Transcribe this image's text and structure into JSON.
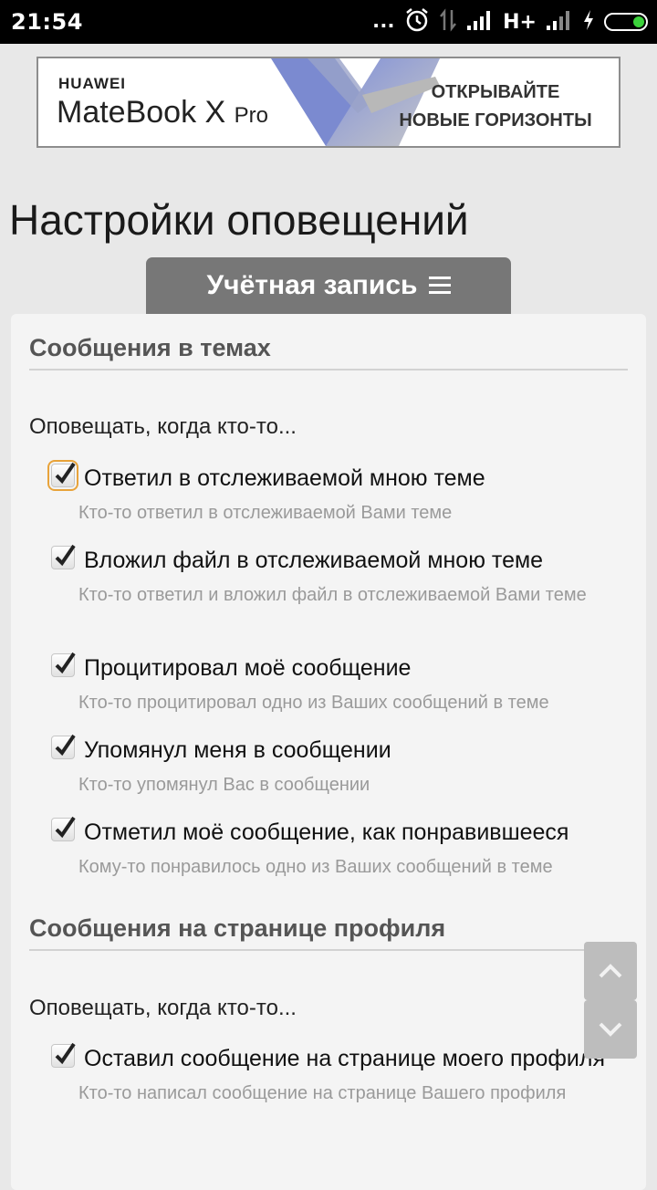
{
  "status_bar": {
    "time": "21:54",
    "dots": "...",
    "network_type": "H+",
    "icons": [
      "alarm-icon",
      "data-transfer-icon",
      "signal-icon",
      "signal-icon",
      "charging-icon",
      "battery-icon"
    ],
    "battery_color": "#3bd23b"
  },
  "ad": {
    "brand": "HUAWEI",
    "product_main": "MateBook X",
    "product_suffix": "Pro",
    "slogan_line1": "ОТКРЫВАЙТЕ",
    "slogan_line2": "НОВЫЕ ГОРИЗОНТЫ"
  },
  "page": {
    "title": "Настройки оповещений",
    "account_tab_label": "Учётная запись"
  },
  "sections": [
    {
      "title": "Сообщения в темах",
      "lead": "Оповещать, когда кто-то...",
      "options": [
        {
          "label": "Ответил в отслеживаемой мною теме",
          "desc": "Кто-то ответил в отслеживаемой Вами теме",
          "checked": true
        },
        {
          "label": "Вложил файл в отслеживаемой мною теме",
          "desc": "Кто-то ответил и вложил файл в отслеживаемой Вами теме",
          "checked": true
        },
        {
          "label": "Процитировал моё сообщение",
          "desc": "Кто-то процитировал одно из Ваших сообщений в теме",
          "checked": true
        },
        {
          "label": "Упомянул меня в сообщении",
          "desc": "Кто-то упомянул Вас в сообщении",
          "checked": true
        },
        {
          "label": "Отметил моё сообщение, как понравившееся",
          "desc": "Кому-то понравилось одно из Ваших сообщений в теме",
          "checked": true
        }
      ]
    },
    {
      "title": "Сообщения на странице профиля",
      "lead": "Оповещать, когда кто-то...",
      "options": [
        {
          "label": "Оставил сообщение на странице моего профиля",
          "desc": "Кто-то написал сообщение на странице Вашего профиля",
          "checked": true
        }
      ]
    }
  ],
  "colors": {
    "accent_focus": "#e8a33a",
    "tab_bg": "#777777",
    "panel_bg": "#f4f4f4"
  }
}
